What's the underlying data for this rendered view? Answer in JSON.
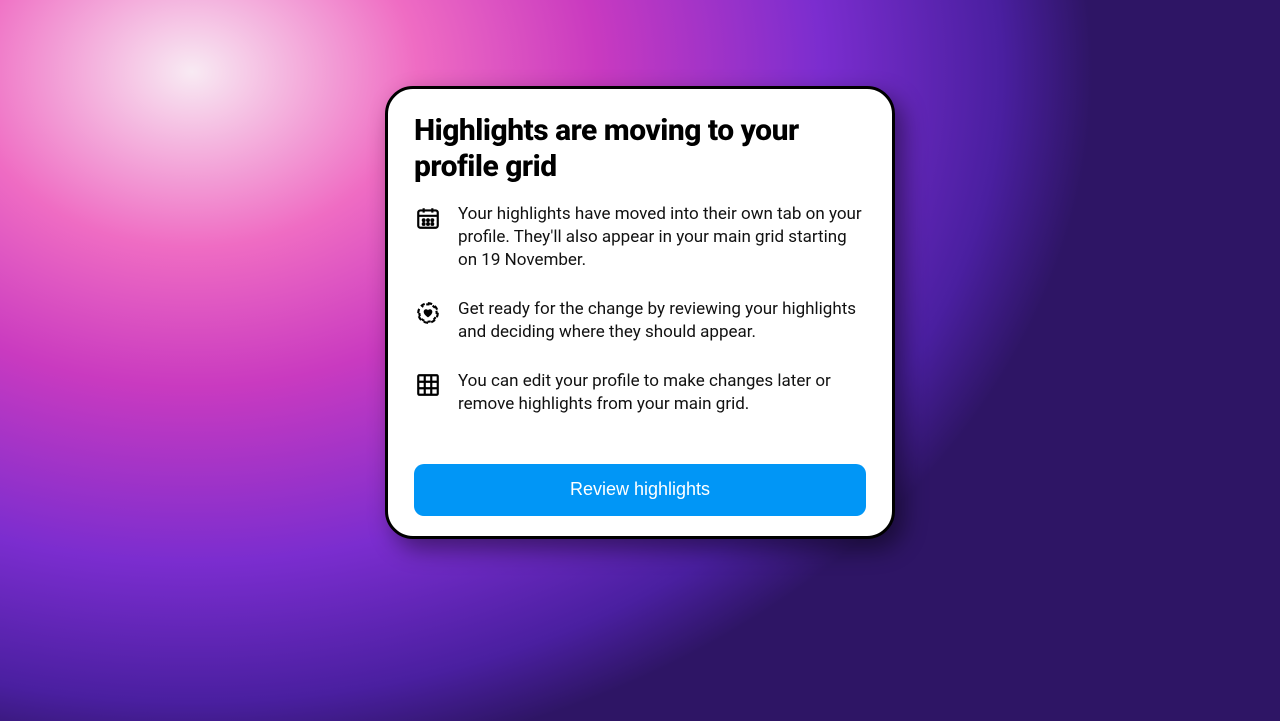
{
  "modal": {
    "title": "Highlights are moving to your profile grid",
    "items": [
      {
        "icon": "calendar-icon",
        "text": "Your highlights have moved into their own tab on your profile. They'll also appear in your main grid starting on 19 November."
      },
      {
        "icon": "heart-circle-icon",
        "text": "Get ready for the change by reviewing your highlights and deciding where they should appear."
      },
      {
        "icon": "grid-icon",
        "text": "You can edit your profile to make changes later or remove highlights from your main grid."
      }
    ],
    "cta_label": "Review highlights"
  },
  "colors": {
    "button_bg": "#0196f6",
    "button_text": "#ffffff",
    "card_bg": "#ffffff",
    "card_border": "#000000"
  }
}
